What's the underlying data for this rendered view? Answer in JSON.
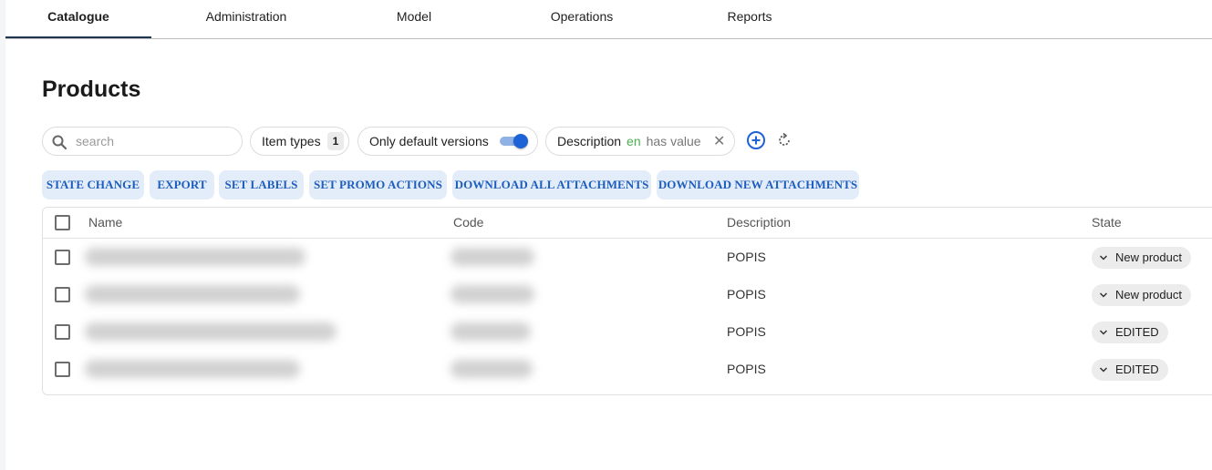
{
  "nav": {
    "tabs": [
      "Catalogue",
      "Administration",
      "Model",
      "Operations",
      "Reports"
    ],
    "active": "Catalogue"
  },
  "page": {
    "title": "Products"
  },
  "filters": {
    "search_placeholder": "search",
    "item_types": {
      "label": "Item types",
      "count": "1"
    },
    "default_versions": {
      "label": "Only default versions",
      "enabled": true
    },
    "description": {
      "field": "Description",
      "lang": "en",
      "condition": "has value"
    }
  },
  "actions": [
    "STATE CHANGE",
    "EXPORT",
    "SET LABELS",
    "SET PROMO ACTIONS",
    "DOWNLOAD ALL ATTACHMENTS",
    "DOWNLOAD NEW ATTACHMENTS"
  ],
  "table": {
    "columns": [
      "Name",
      "Code",
      "Description",
      "State"
    ],
    "rows": [
      {
        "description": "POPIS",
        "state": "New product"
      },
      {
        "description": "POPIS",
        "state": "New product"
      },
      {
        "description": "POPIS",
        "state": "EDITED"
      },
      {
        "description": "POPIS",
        "state": "EDITED"
      }
    ]
  },
  "colors": {
    "accent": "#1d62d6",
    "action_bg": "#e3edf9",
    "action_text": "#1d5dbf",
    "lang_green": "#4caf50"
  },
  "icons": [
    "search-icon",
    "add-circle-icon",
    "reset-icon",
    "close-icon",
    "chevron-down-icon"
  ]
}
